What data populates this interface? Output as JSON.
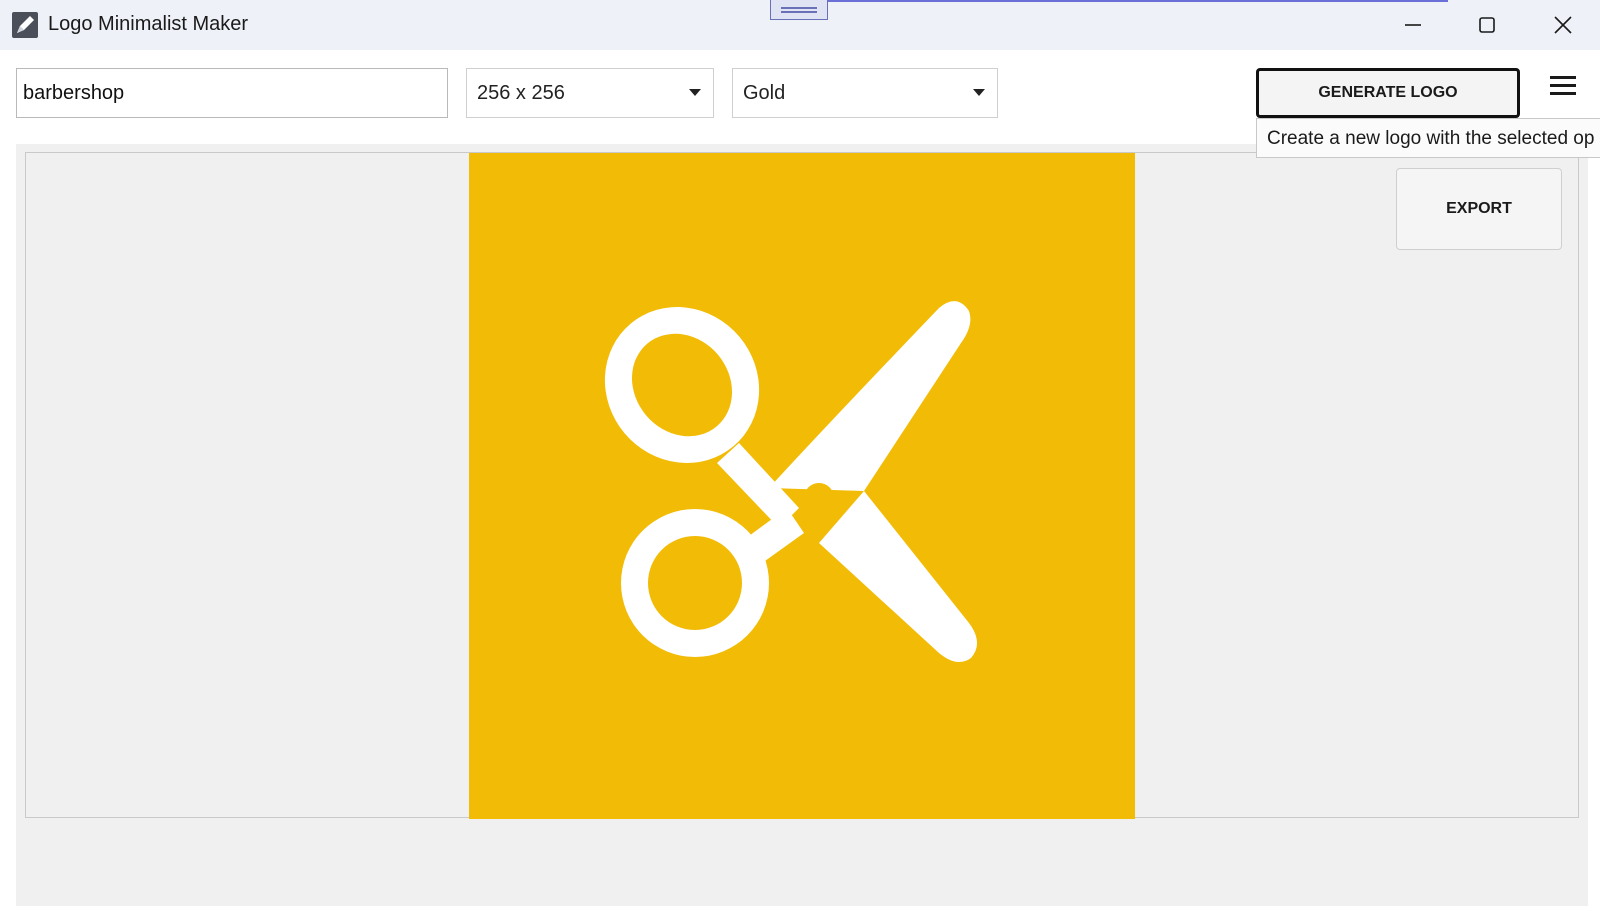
{
  "window": {
    "title": "Logo Minimalist Maker"
  },
  "toolbar": {
    "keyword_value": "barbershop",
    "size_selected": "256 x 256",
    "color_selected": "Gold",
    "generate_label": "GENERATE LOGO",
    "generate_tooltip": "Create a new logo with the selected op"
  },
  "preview": {
    "export_label": "EXPORT",
    "logo_icon": "scissors-icon",
    "logo_background": "#f2bb05",
    "logo_foreground": "#ffffff"
  },
  "icons": {
    "app": "app-pen-icon",
    "minimize": "minimize-icon",
    "maximize": "maximize-icon",
    "close": "close-icon",
    "menu": "hamburger-menu-icon",
    "dropdown": "chevron-down-icon"
  }
}
